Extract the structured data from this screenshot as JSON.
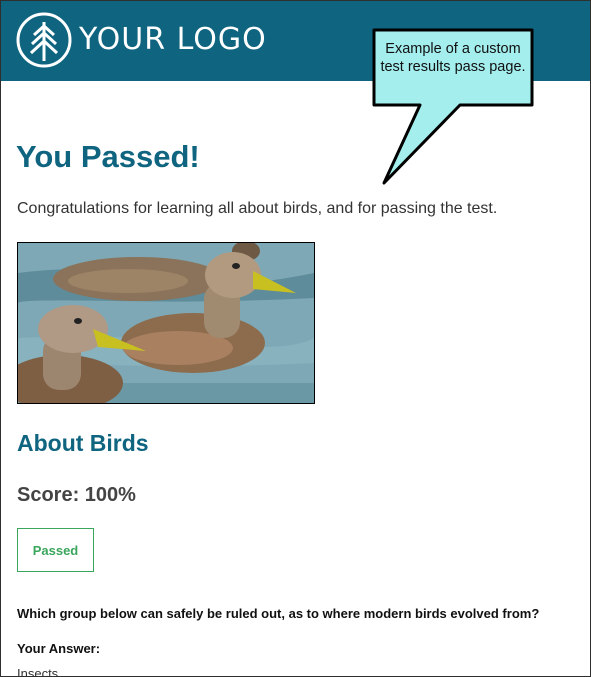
{
  "header": {
    "logo_text": "YOUR LOGO",
    "logo_icon": "tree-icon",
    "background_color": "#0f6480"
  },
  "callout": {
    "text": "Example of a custom test results pass page.",
    "fill_color": "#a4eeee"
  },
  "main": {
    "title": "You Passed!",
    "intro": "Congratulations for learning all about birds, and for passing the test.",
    "image_alt": "two ducks swimming",
    "section_title": "About Birds",
    "score_label": "Score: 100%",
    "status_badge": "Passed",
    "status_color": "#3aa65c",
    "question": "Which group below can safely be ruled out, as to where modern birds evolved from?",
    "your_answer_label": "Your Answer:",
    "your_answer_value": "Insects"
  }
}
